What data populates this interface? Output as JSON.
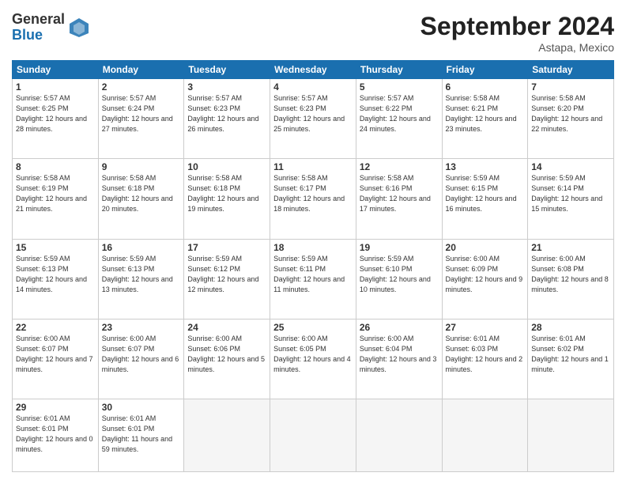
{
  "header": {
    "logo_line1": "General",
    "logo_line2": "Blue",
    "month_title": "September 2024",
    "location": "Astapa, Mexico"
  },
  "days_of_week": [
    "Sunday",
    "Monday",
    "Tuesday",
    "Wednesday",
    "Thursday",
    "Friday",
    "Saturday"
  ],
  "weeks": [
    [
      {
        "day": "1",
        "sunrise": "Sunrise: 5:57 AM",
        "sunset": "Sunset: 6:25 PM",
        "daylight": "Daylight: 12 hours and 28 minutes."
      },
      {
        "day": "2",
        "sunrise": "Sunrise: 5:57 AM",
        "sunset": "Sunset: 6:24 PM",
        "daylight": "Daylight: 12 hours and 27 minutes."
      },
      {
        "day": "3",
        "sunrise": "Sunrise: 5:57 AM",
        "sunset": "Sunset: 6:23 PM",
        "daylight": "Daylight: 12 hours and 26 minutes."
      },
      {
        "day": "4",
        "sunrise": "Sunrise: 5:57 AM",
        "sunset": "Sunset: 6:23 PM",
        "daylight": "Daylight: 12 hours and 25 minutes."
      },
      {
        "day": "5",
        "sunrise": "Sunrise: 5:57 AM",
        "sunset": "Sunset: 6:22 PM",
        "daylight": "Daylight: 12 hours and 24 minutes."
      },
      {
        "day": "6",
        "sunrise": "Sunrise: 5:58 AM",
        "sunset": "Sunset: 6:21 PM",
        "daylight": "Daylight: 12 hours and 23 minutes."
      },
      {
        "day": "7",
        "sunrise": "Sunrise: 5:58 AM",
        "sunset": "Sunset: 6:20 PM",
        "daylight": "Daylight: 12 hours and 22 minutes."
      }
    ],
    [
      {
        "day": "8",
        "sunrise": "Sunrise: 5:58 AM",
        "sunset": "Sunset: 6:19 PM",
        "daylight": "Daylight: 12 hours and 21 minutes."
      },
      {
        "day": "9",
        "sunrise": "Sunrise: 5:58 AM",
        "sunset": "Sunset: 6:18 PM",
        "daylight": "Daylight: 12 hours and 20 minutes."
      },
      {
        "day": "10",
        "sunrise": "Sunrise: 5:58 AM",
        "sunset": "Sunset: 6:18 PM",
        "daylight": "Daylight: 12 hours and 19 minutes."
      },
      {
        "day": "11",
        "sunrise": "Sunrise: 5:58 AM",
        "sunset": "Sunset: 6:17 PM",
        "daylight": "Daylight: 12 hours and 18 minutes."
      },
      {
        "day": "12",
        "sunrise": "Sunrise: 5:58 AM",
        "sunset": "Sunset: 6:16 PM",
        "daylight": "Daylight: 12 hours and 17 minutes."
      },
      {
        "day": "13",
        "sunrise": "Sunrise: 5:59 AM",
        "sunset": "Sunset: 6:15 PM",
        "daylight": "Daylight: 12 hours and 16 minutes."
      },
      {
        "day": "14",
        "sunrise": "Sunrise: 5:59 AM",
        "sunset": "Sunset: 6:14 PM",
        "daylight": "Daylight: 12 hours and 15 minutes."
      }
    ],
    [
      {
        "day": "15",
        "sunrise": "Sunrise: 5:59 AM",
        "sunset": "Sunset: 6:13 PM",
        "daylight": "Daylight: 12 hours and 14 minutes."
      },
      {
        "day": "16",
        "sunrise": "Sunrise: 5:59 AM",
        "sunset": "Sunset: 6:13 PM",
        "daylight": "Daylight: 12 hours and 13 minutes."
      },
      {
        "day": "17",
        "sunrise": "Sunrise: 5:59 AM",
        "sunset": "Sunset: 6:12 PM",
        "daylight": "Daylight: 12 hours and 12 minutes."
      },
      {
        "day": "18",
        "sunrise": "Sunrise: 5:59 AM",
        "sunset": "Sunset: 6:11 PM",
        "daylight": "Daylight: 12 hours and 11 minutes."
      },
      {
        "day": "19",
        "sunrise": "Sunrise: 5:59 AM",
        "sunset": "Sunset: 6:10 PM",
        "daylight": "Daylight: 12 hours and 10 minutes."
      },
      {
        "day": "20",
        "sunrise": "Sunrise: 6:00 AM",
        "sunset": "Sunset: 6:09 PM",
        "daylight": "Daylight: 12 hours and 9 minutes."
      },
      {
        "day": "21",
        "sunrise": "Sunrise: 6:00 AM",
        "sunset": "Sunset: 6:08 PM",
        "daylight": "Daylight: 12 hours and 8 minutes."
      }
    ],
    [
      {
        "day": "22",
        "sunrise": "Sunrise: 6:00 AM",
        "sunset": "Sunset: 6:07 PM",
        "daylight": "Daylight: 12 hours and 7 minutes."
      },
      {
        "day": "23",
        "sunrise": "Sunrise: 6:00 AM",
        "sunset": "Sunset: 6:07 PM",
        "daylight": "Daylight: 12 hours and 6 minutes."
      },
      {
        "day": "24",
        "sunrise": "Sunrise: 6:00 AM",
        "sunset": "Sunset: 6:06 PM",
        "daylight": "Daylight: 12 hours and 5 minutes."
      },
      {
        "day": "25",
        "sunrise": "Sunrise: 6:00 AM",
        "sunset": "Sunset: 6:05 PM",
        "daylight": "Daylight: 12 hours and 4 minutes."
      },
      {
        "day": "26",
        "sunrise": "Sunrise: 6:00 AM",
        "sunset": "Sunset: 6:04 PM",
        "daylight": "Daylight: 12 hours and 3 minutes."
      },
      {
        "day": "27",
        "sunrise": "Sunrise: 6:01 AM",
        "sunset": "Sunset: 6:03 PM",
        "daylight": "Daylight: 12 hours and 2 minutes."
      },
      {
        "day": "28",
        "sunrise": "Sunrise: 6:01 AM",
        "sunset": "Sunset: 6:02 PM",
        "daylight": "Daylight: 12 hours and 1 minute."
      }
    ],
    [
      {
        "day": "29",
        "sunrise": "Sunrise: 6:01 AM",
        "sunset": "Sunset: 6:01 PM",
        "daylight": "Daylight: 12 hours and 0 minutes."
      },
      {
        "day": "30",
        "sunrise": "Sunrise: 6:01 AM",
        "sunset": "Sunset: 6:01 PM",
        "daylight": "Daylight: 11 hours and 59 minutes."
      },
      null,
      null,
      null,
      null,
      null
    ]
  ]
}
